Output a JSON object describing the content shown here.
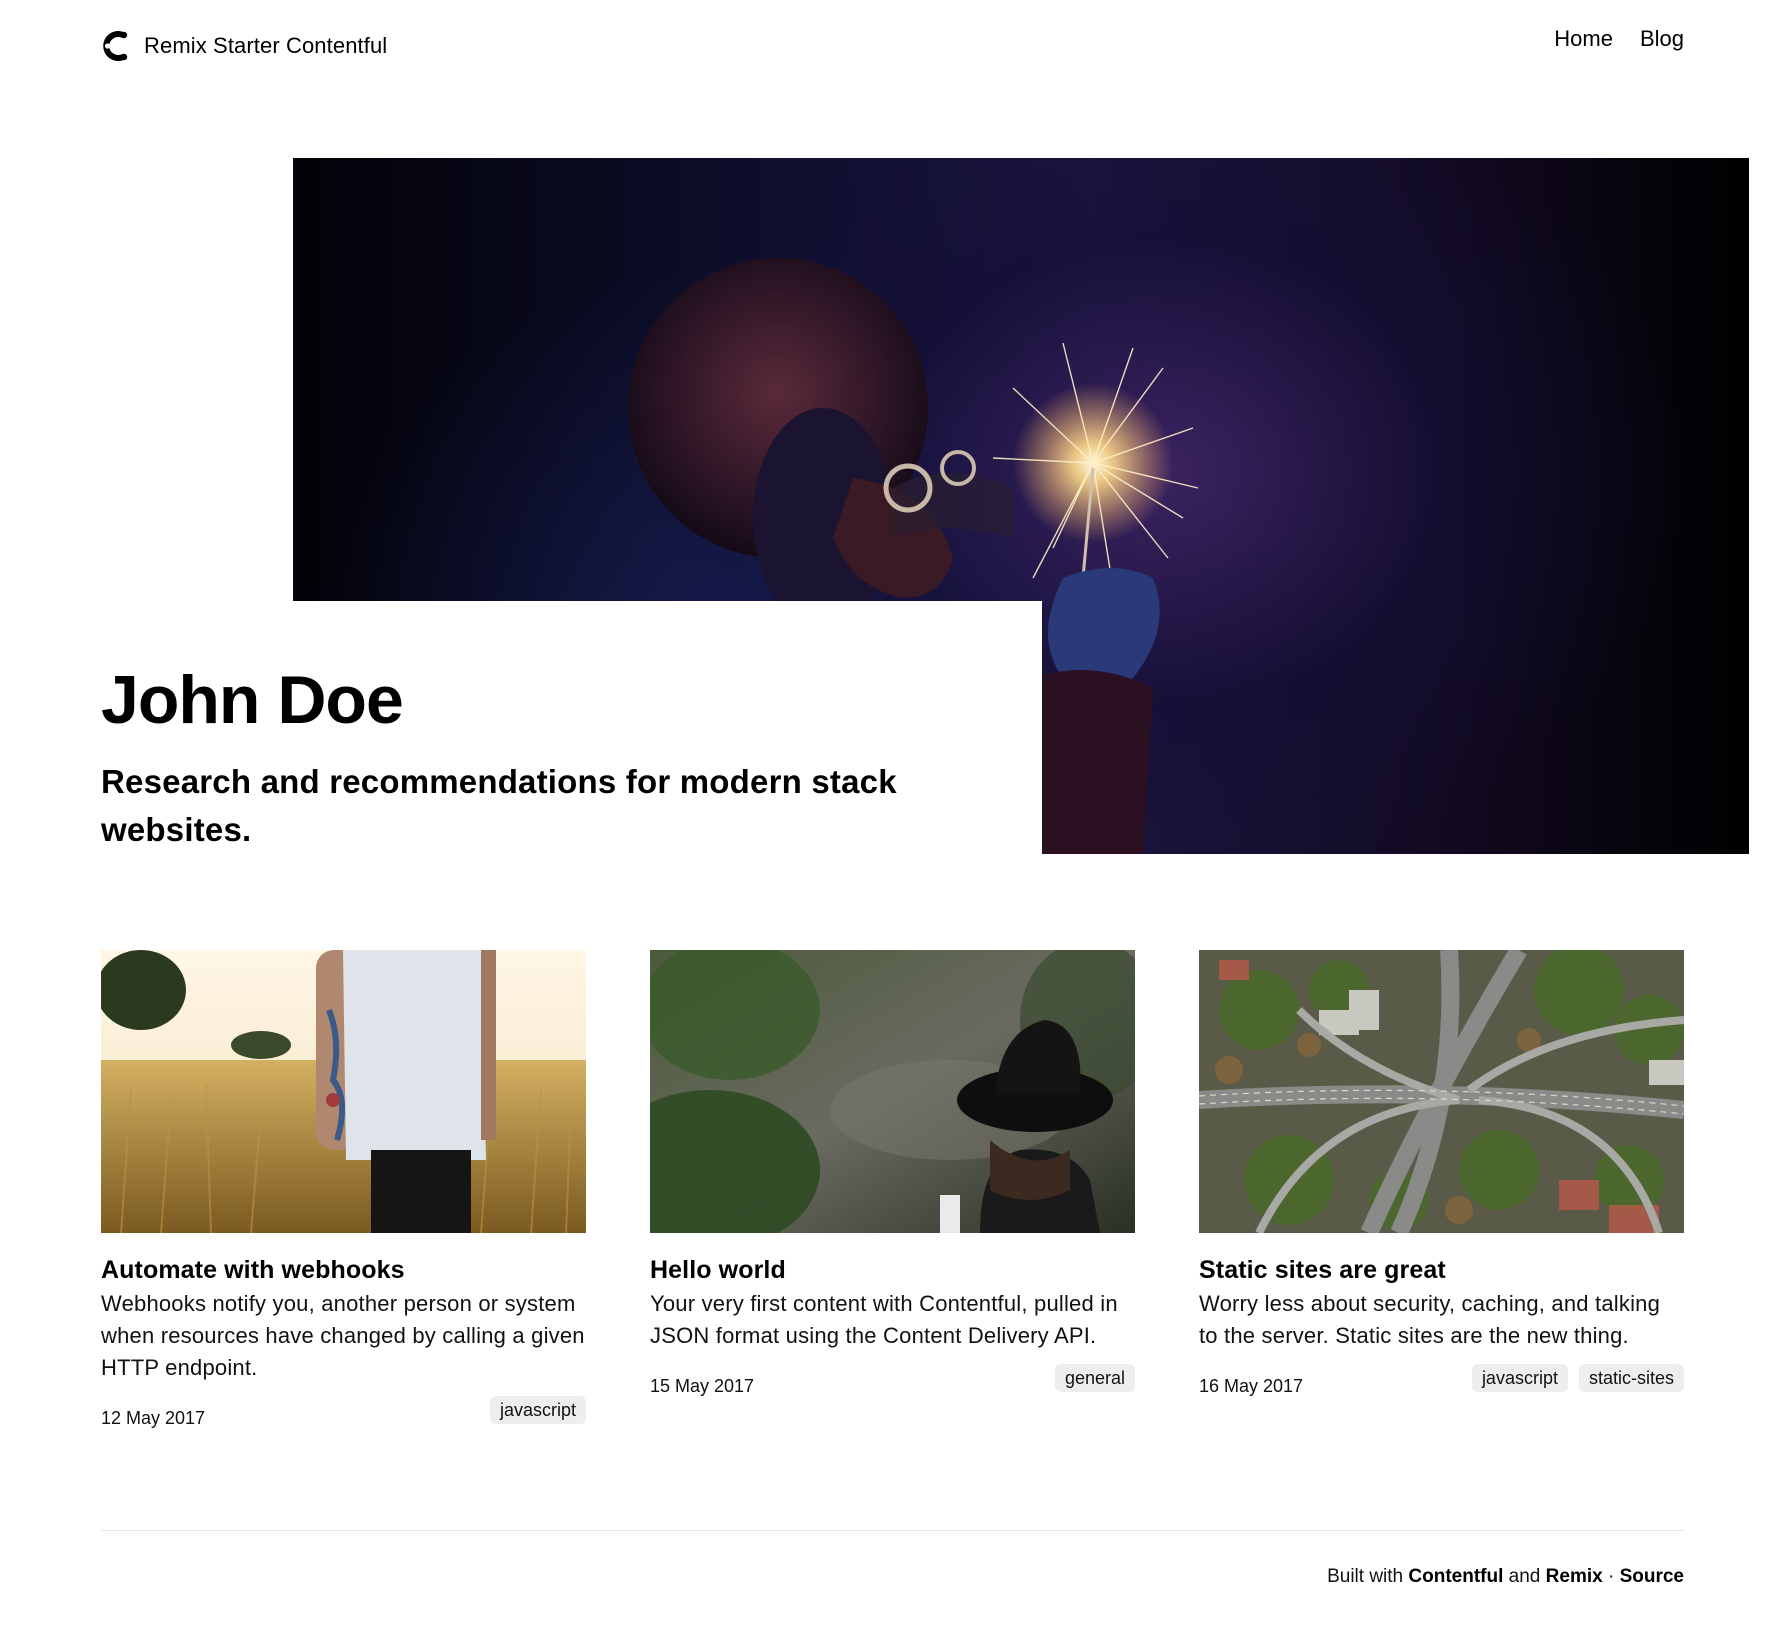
{
  "header": {
    "site_title": "Remix Starter Contentful",
    "logo_icon": "contentful-logo-icon",
    "nav": [
      {
        "label": "Home"
      },
      {
        "label": "Blog"
      }
    ]
  },
  "hero": {
    "name": "John Doe",
    "subtitle": "Research and recommendations for modern stack websites.",
    "image_alt": "person with sparkler"
  },
  "posts": [
    {
      "title": "Automate with webhooks",
      "description": "Webhooks notify you, another person or system when resources have changed by calling a given HTTP endpoint.",
      "date": "12 May 2017",
      "tags": [
        "javascript"
      ],
      "image": "field-tattoo-photo"
    },
    {
      "title": "Hello world",
      "description": "Your very first content with Contentful, pulled in JSON format using the Content Delivery API.",
      "date": "15 May 2017",
      "tags": [
        "general"
      ],
      "image": "hat-forest-photo"
    },
    {
      "title": "Static sites are great",
      "description": "Worry less about security, caching, and talking to the server. Static sites are the new thing.",
      "date": "16 May 2017",
      "tags": [
        "javascript",
        "static-sites"
      ],
      "image": "highway-aerial-photo"
    }
  ],
  "footer": {
    "prefix": "Built with",
    "link1": "Contentful",
    "and": "and",
    "link2": "Remix",
    "separator": "·",
    "link3": "Source"
  }
}
